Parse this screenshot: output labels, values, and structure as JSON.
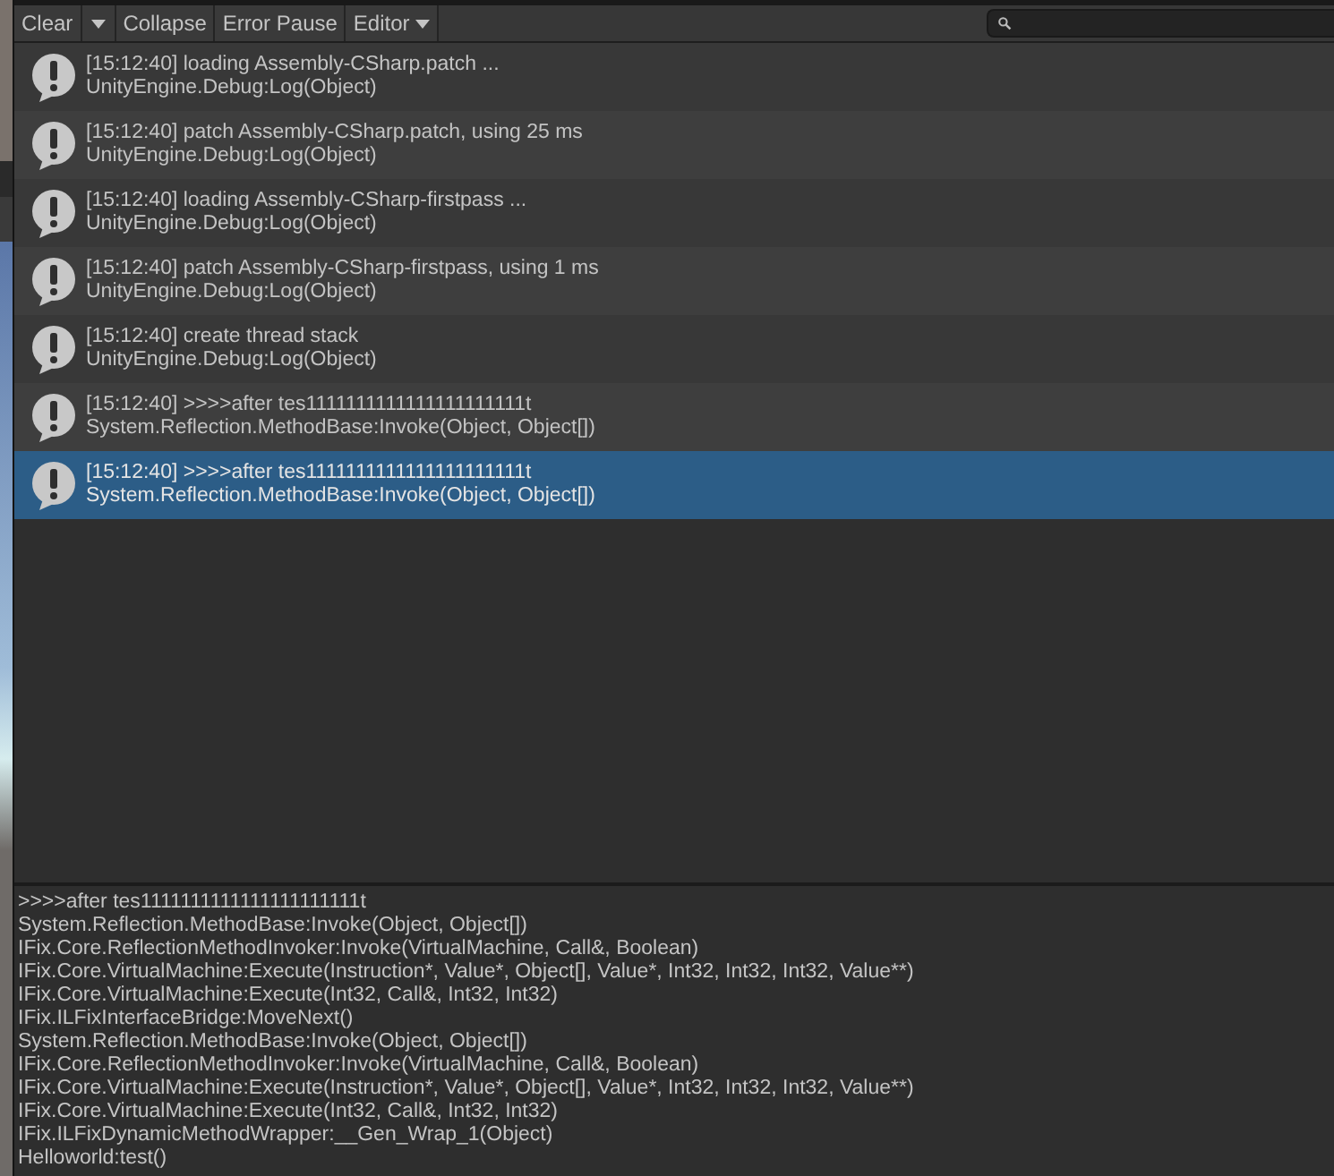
{
  "toolbar": {
    "buttons": [
      {
        "label": "Clear",
        "kind": "split"
      },
      {
        "label": "Collapse",
        "kind": "button"
      },
      {
        "label": "Error Pause",
        "kind": "button"
      },
      {
        "label": "Editor",
        "kind": "dropdown"
      }
    ],
    "search": {
      "kind": "search"
    }
  },
  "entries": [
    {
      "message": "[15:12:40] loading Assembly-CSharp.patch ...",
      "stack": "UnityEngine.Debug:Log(Object)",
      "selected": false
    },
    {
      "message": "[15:12:40] patch Assembly-CSharp.patch, using 25 ms",
      "stack": "UnityEngine.Debug:Log(Object)",
      "selected": false
    },
    {
      "message": "[15:12:40] loading Assembly-CSharp-firstpass ...",
      "stack": "UnityEngine.Debug:Log(Object)",
      "selected": false
    },
    {
      "message": "[15:12:40] patch Assembly-CSharp-firstpass, using 1 ms",
      "stack": "UnityEngine.Debug:Log(Object)",
      "selected": false
    },
    {
      "message": "[15:12:40] create thread stack",
      "stack": "UnityEngine.Debug:Log(Object)",
      "selected": false
    },
    {
      "message": "[15:12:40] >>>>after tes1111111111111111111111t",
      "stack": "System.Reflection.MethodBase:Invoke(Object, Object[])",
      "selected": false
    },
    {
      "message": "[15:12:40] >>>>after tes1111111111111111111111t",
      "stack": "System.Reflection.MethodBase:Invoke(Object, Object[])",
      "selected": true
    }
  ],
  "details": [
    ">>>>after tes1111111111111111111111t",
    "System.Reflection.MethodBase:Invoke(Object, Object[])",
    "IFix.Core.ReflectionMethodInvoker:Invoke(VirtualMachine, Call&, Boolean)",
    "IFix.Core.VirtualMachine:Execute(Instruction*, Value*, Object[], Value*, Int32, Int32, Int32, Value**)",
    "IFix.Core.VirtualMachine:Execute(Int32, Call&, Int32, Int32)",
    "IFix.ILFixInterfaceBridge:MoveNext()",
    "System.Reflection.MethodBase:Invoke(Object, Object[])",
    "IFix.Core.ReflectionMethodInvoker:Invoke(VirtualMachine, Call&, Boolean)",
    "IFix.Core.VirtualMachine:Execute(Instruction*, Value*, Object[], Value*, Int32, Int32, Int32, Value**)",
    "IFix.Core.VirtualMachine:Execute(Int32, Call&, Int32, Int32)",
    "IFix.ILFixDynamicMethodWrapper:__Gen_Wrap_1(Object)",
    "Helloworld:test()"
  ]
}
